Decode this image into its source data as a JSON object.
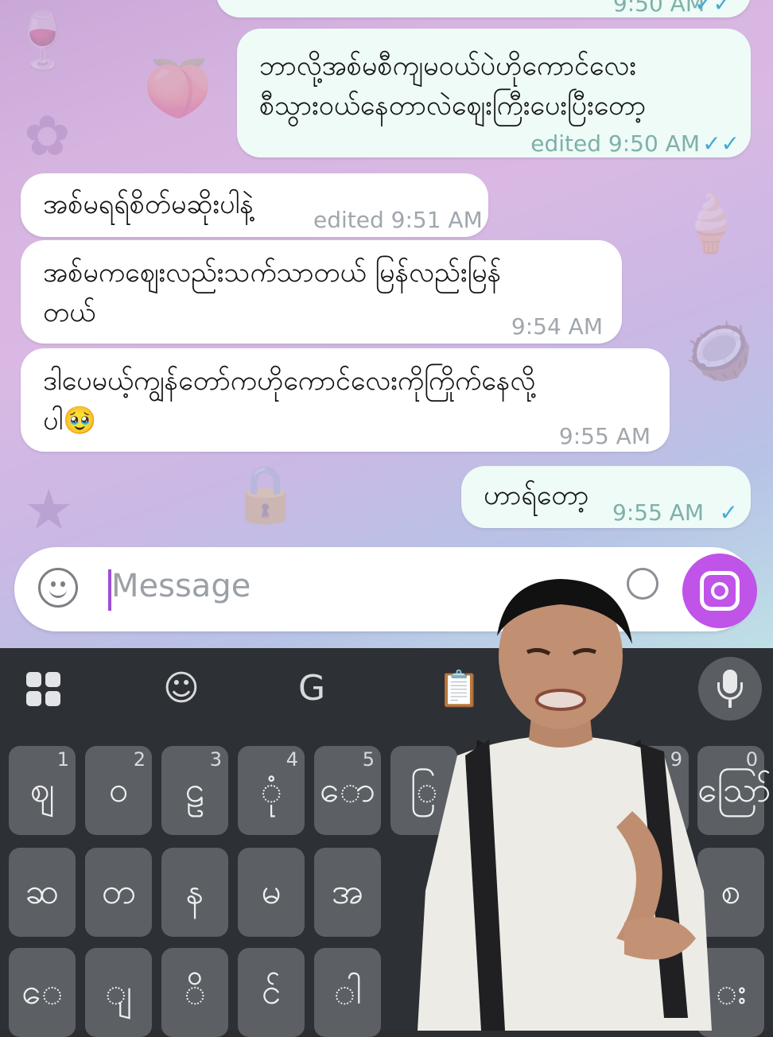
{
  "messages": [
    {
      "dir": "out",
      "text": "",
      "meta": "9:50 AM",
      "status": "read"
    },
    {
      "dir": "out",
      "text": "ဘာလို့အစ်မစီကျမဝယ်ပဲဟိုကောင်လေး\nစီသွားဝယ်နေတာလဲဈေးကြီးပေးပြီးတော့",
      "meta": "edited 9:50 AM",
      "status": "read"
    },
    {
      "dir": "in",
      "text": "အစ်မရရ်စိတ်မဆိုးပါနဲ့",
      "meta": "edited 9:51 AM"
    },
    {
      "dir": "in",
      "text": "အစ်မကဈေးလည်းသက်သာတယ် မြန်လည်းမြန်\nတယ်",
      "meta": "9:54 AM"
    },
    {
      "dir": "in",
      "text": "ဒါပေမယ့်ကျွန်တော်ကဟိုကောင်လေးကိုကြိုက်နေလို့\nပါ🥹",
      "meta": "9:55 AM"
    },
    {
      "dir": "out",
      "text": "ဟာရ်တော့",
      "meta": "9:55 AM",
      "status": "sent"
    }
  ],
  "composer": {
    "placeholder": "Message",
    "emoji_icon": "smiley-icon",
    "camera_icon": "camera-icon",
    "attach_icon": "attach-icon"
  },
  "keyboard": {
    "toolbar": [
      "grid-icon",
      "sticker-icon",
      "translate-icon",
      "clipboard-icon",
      "mic-icon"
    ],
    "row1": [
      {
        "char": "ဈ",
        "hint": "1"
      },
      {
        "char": "ဝ",
        "hint": "2"
      },
      {
        "char": "ဠ",
        "hint": "3"
      },
      {
        "char": "ုံ",
        "hint": "4"
      },
      {
        "char": "ော",
        "hint": "5"
      },
      {
        "char": "ြ",
        "hint": ""
      },
      {
        "char": "ဪ",
        "hint": "0"
      }
    ],
    "row2": [
      {
        "char": "ဆ"
      },
      {
        "char": "တ"
      },
      {
        "char": "န"
      },
      {
        "char": "မ"
      },
      {
        "char": "အ"
      },
      {
        "char": "စ"
      }
    ],
    "row3": [
      {
        "char": "ေ"
      },
      {
        "char": "ျ"
      },
      {
        "char": "ိ"
      },
      {
        "char": "င်"
      },
      {
        "char": "ါ"
      },
      {
        "char": "း"
      }
    ],
    "hint_9": "9"
  },
  "colors": {
    "accent": "#c053e8",
    "check": "#48a9d6",
    "outgoing_bubble": "#eefbf7",
    "incoming_bubble": "#ffffff",
    "keyboard_bg": "#2d3034",
    "key_bg": "#5c5f64"
  }
}
